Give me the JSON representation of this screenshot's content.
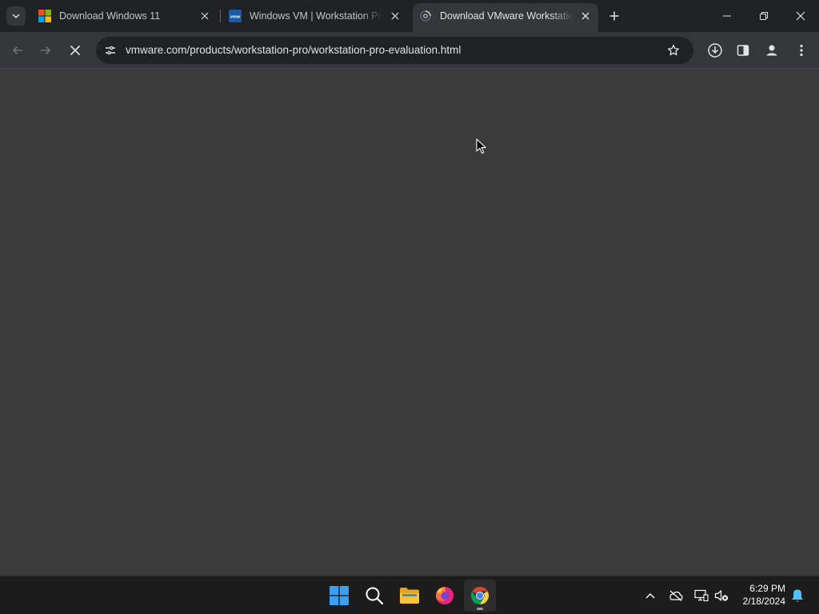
{
  "browser": {
    "tabs": [
      {
        "title": "Download Windows 11",
        "favicon": "microsoft-logo-icon",
        "active": false
      },
      {
        "title": "Windows VM | Workstation Pro",
        "favicon": "vmware-logo-icon",
        "active": false
      },
      {
        "title": "Download VMware Workstation Pro",
        "favicon": "loading-spinner-icon",
        "active": true
      }
    ],
    "toolbar": {
      "url": "vmware.com/products/workstation-pro/workstation-pro-evaluation.html",
      "back_icon": "back-arrow-icon",
      "forward_icon": "forward-arrow-icon",
      "stop_icon": "stop-loading-icon"
    }
  },
  "taskbar": {
    "apps": [
      "start",
      "search",
      "file-explorer",
      "firefox",
      "chrome"
    ],
    "clock": {
      "time": "6:29 PM",
      "date": "2/18/2024"
    }
  },
  "colors": {
    "tab_strip": "#202124",
    "toolbar": "#35363a",
    "content": "#3b3b3b",
    "taskbar": "#1c1c1c",
    "windows_blue": "#3aa0f3"
  }
}
